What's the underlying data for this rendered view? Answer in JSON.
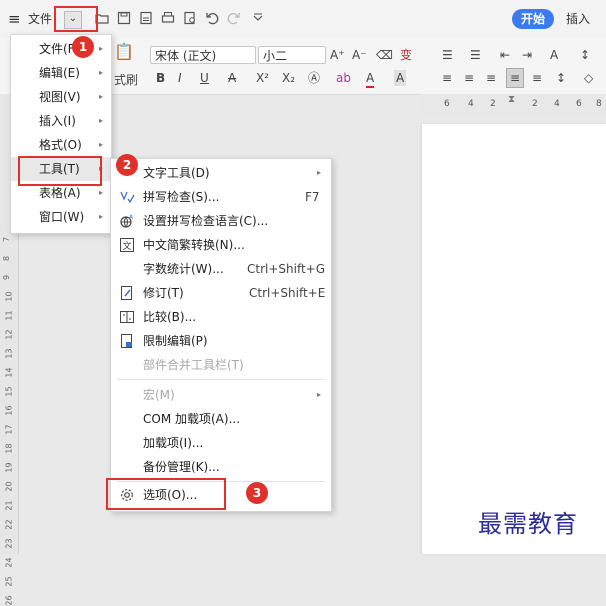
{
  "titlebar": {
    "file_label": "文件",
    "start_tab": "开始",
    "insert_tab": "插入"
  },
  "ribbon": {
    "font_name": "宋体 (正文)",
    "font_size": "小二",
    "format_painter": "式刷",
    "bold": "B",
    "italic": "I",
    "underline": "U",
    "font_color": "A",
    "superscript": "X²",
    "subscript": "X₂",
    "grow_font": "A⁺",
    "shrink_font": "A⁻",
    "pinyin": "变"
  },
  "ruler": [
    "6",
    "4",
    "2",
    "2",
    "4",
    "6",
    "8"
  ],
  "left_ruler": [
    "7",
    "8",
    "9",
    "10",
    "11",
    "12",
    "13",
    "14",
    "15",
    "16",
    "17",
    "18",
    "19",
    "20",
    "21",
    "22",
    "23",
    "24",
    "25",
    "26"
  ],
  "file_menu": {
    "items": [
      {
        "label": "文件(F)"
      },
      {
        "label": "编辑(E)"
      },
      {
        "label": "视图(V)"
      },
      {
        "label": "插入(I)"
      },
      {
        "label": "格式(O)"
      },
      {
        "label": "工具(T)"
      },
      {
        "label": "表格(A)"
      },
      {
        "label": "窗口(W)"
      }
    ]
  },
  "tools_menu": {
    "items": [
      {
        "label": "文字工具(D)",
        "shortcut": ""
      },
      {
        "label": "拼写检查(S)...",
        "shortcut": "F7"
      },
      {
        "label": "设置拼写检查语言(C)...",
        "shortcut": ""
      },
      {
        "label": "中文简繁转换(N)...",
        "shortcut": ""
      },
      {
        "label": "字数统计(W)...",
        "shortcut": "Ctrl+Shift+G"
      },
      {
        "label": "修订(T)",
        "shortcut": "Ctrl+Shift+E"
      },
      {
        "label": "比较(B)...",
        "shortcut": ""
      },
      {
        "label": "限制编辑(P)",
        "shortcut": ""
      },
      {
        "label": "部件合并工具栏(T)",
        "shortcut": ""
      },
      {
        "label": "宏(M)",
        "shortcut": ""
      },
      {
        "label": "COM 加载项(A)...",
        "shortcut": ""
      },
      {
        "label": "加载项(I)...",
        "shortcut": ""
      },
      {
        "label": "备份管理(K)...",
        "shortcut": ""
      },
      {
        "label": "选项(O)...",
        "shortcut": ""
      }
    ]
  },
  "badges": [
    "1",
    "2",
    "3"
  ],
  "watermark": "最需教育",
  "colors": {
    "accent": "#3b7bef",
    "highlight_red": "#e0312b"
  }
}
